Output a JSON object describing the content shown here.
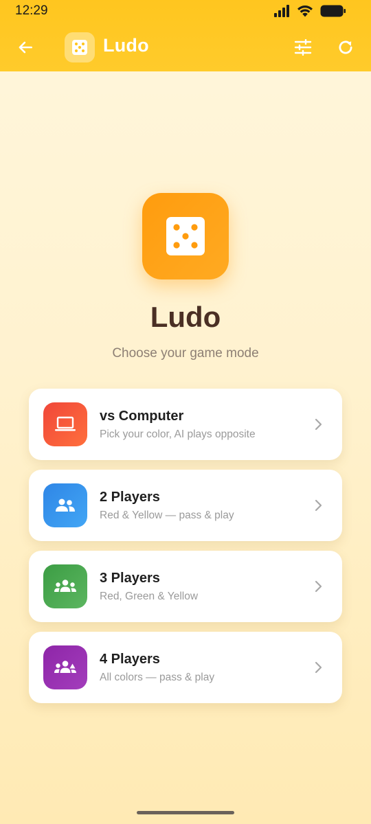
{
  "status_bar": {
    "time": "12:29"
  },
  "app_bar": {
    "title": "Ludo",
    "back_icon": "arrow-left-icon",
    "logo_icon": "dice-icon",
    "settings_icon": "tune-sliders-icon",
    "refresh_icon": "refresh-icon"
  },
  "hero": {
    "title": "Ludo",
    "subtitle": "Choose your game mode",
    "icon": "dice-five-icon"
  },
  "modes": [
    {
      "title": "vs Computer",
      "description": "Pick your color, AI plays opposite",
      "icon": "laptop-icon",
      "color_start": "#f0473a",
      "color_end": "#ff6f3c"
    },
    {
      "title": "2 Players",
      "description": "Red & Yellow — pass & play",
      "icon": "two-people-icon",
      "color_start": "#2f86e6",
      "color_end": "#42a6f5"
    },
    {
      "title": "3 Players",
      "description": "Red, Green & Yellow",
      "icon": "group-icon",
      "color_start": "#3c9d44",
      "color_end": "#5cb660"
    },
    {
      "title": "4 Players",
      "description": "All colors — pass & play",
      "icon": "group-four-icon",
      "color_start": "#8e26a8",
      "color_end": "#a33dbc"
    }
  ],
  "colors": {
    "header": "#ffc61f",
    "accent_orange": "#ff9c0e",
    "title_brown": "#4a2f24"
  }
}
